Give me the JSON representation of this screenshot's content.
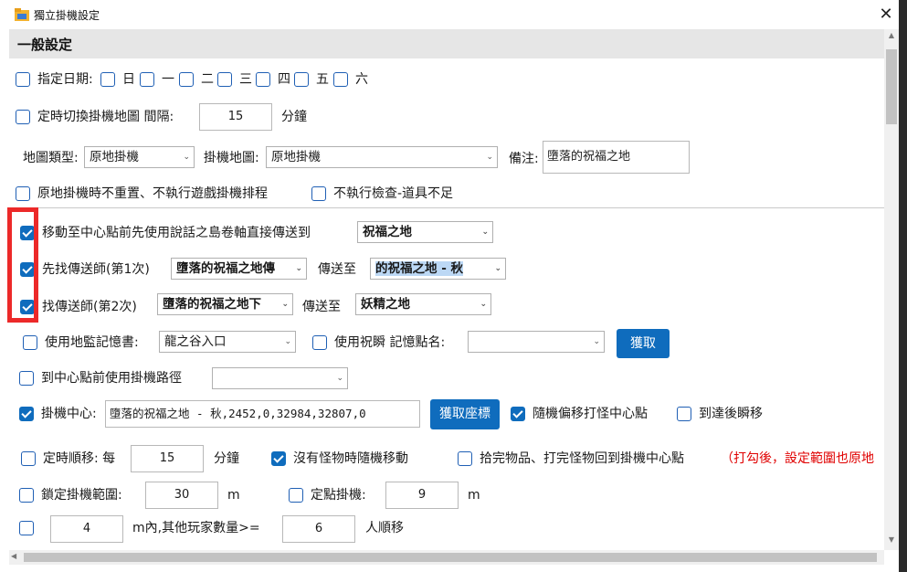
{
  "window": {
    "title": "獨立掛機設定",
    "close_glyph": "✕"
  },
  "section": {
    "title": "一般設定"
  },
  "days": {
    "label": "指定日期:",
    "items": [
      "日",
      "一",
      "二",
      "三",
      "四",
      "五",
      "六"
    ]
  },
  "switch_map": {
    "label": "定時切換掛機地圖 間隔:",
    "value": "15",
    "unit": "分鐘"
  },
  "map_type": {
    "label": "地圖類型:",
    "value": "原地掛機"
  },
  "hang_map": {
    "label": "掛機地圖:",
    "value": "原地掛機"
  },
  "note": {
    "label": "備注:",
    "value": "墮落的祝福之地"
  },
  "no_reset": {
    "label": "原地掛機時不重置、不執行遊戲掛機排程"
  },
  "no_check": {
    "label": "不執行檢查-道具不足"
  },
  "teleport_scroll": {
    "label": "移動至中心點前先使用說話之島卷軸直接傳送到",
    "value": "祝福之地"
  },
  "teleporter1": {
    "label": "先找傳送師(第1次)",
    "value": "墮落的祝福之地傳",
    "to_label": "傳送至",
    "to_value": "的祝福之地 - 秋"
  },
  "teleporter2": {
    "label": "找傳送師(第2次)",
    "value": "墮落的祝福之地下",
    "to_label": "傳送至",
    "to_value": "妖精之地"
  },
  "memory_book": {
    "label": "使用地監記憶書:",
    "value": "龍之谷入口"
  },
  "blink": {
    "label": "使用祝瞬 記憶點名:",
    "value": "",
    "button": "獲取"
  },
  "route": {
    "label": "到中心點前使用掛機路徑",
    "value": ""
  },
  "center": {
    "label": "掛機中心:",
    "value": "墮落的祝福之地 - 秋,2452,0,32984,32807,0",
    "button": "獲取座標"
  },
  "random_offset": {
    "label": "隨機偏移打怪中心點"
  },
  "arrive_blink": {
    "label": "到達後瞬移"
  },
  "timed_move": {
    "label": "定時順移: 每",
    "value": "15",
    "unit": "分鐘"
  },
  "random_move": {
    "label": "沒有怪物時隨機移動"
  },
  "return_center": {
    "label": "拾完物品、打完怪物回到掛機中心點"
  },
  "warning": {
    "text": "（打勾後，設定範圍也原地"
  },
  "lock_range": {
    "label": "鎖定掛機範圍:",
    "value": "30",
    "unit": "m"
  },
  "fixed_point": {
    "label": "定點掛機:",
    "value": "9",
    "unit": "m"
  },
  "players": {
    "value": "4",
    "mid": "m內,其他玩家數量>=",
    "count": "6",
    "suffix": "人順移"
  },
  "colors": {
    "accent": "#0f6cbd",
    "highlight_box": "#ec2929",
    "warning": "#e00000"
  }
}
